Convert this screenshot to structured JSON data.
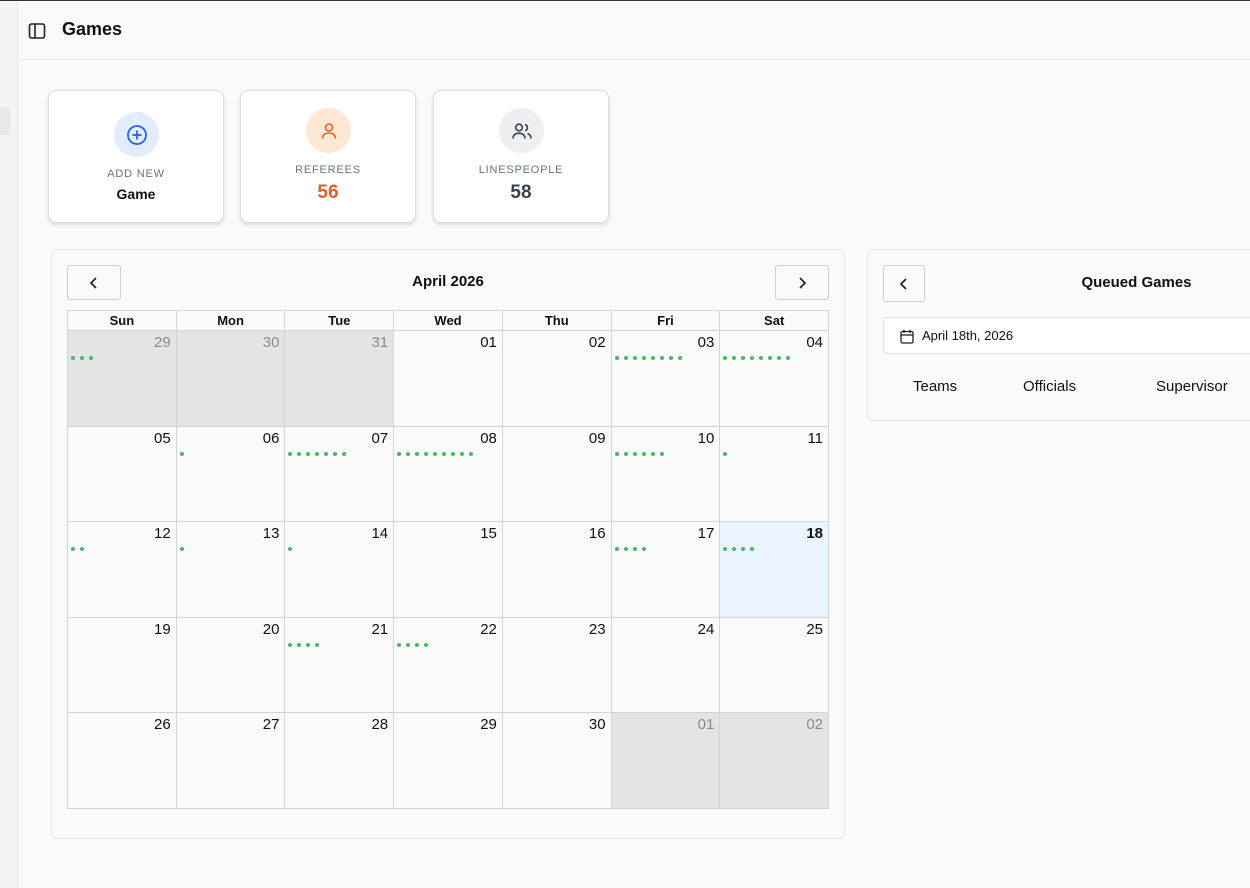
{
  "header": {
    "title": "Games"
  },
  "cards": {
    "add_new": {
      "label": "ADD NEW",
      "value": "Game"
    },
    "referees": {
      "label": "REFEREES",
      "value": "56"
    },
    "linespeople": {
      "label": "LINESPEOPLE",
      "value": "58"
    }
  },
  "colors": {
    "add": "#2563eb",
    "referees": "#d9622b",
    "linespeople": "#374151",
    "dot": "#4ab864",
    "today": "#eaf4ff"
  },
  "calendar": {
    "title": "April 2026",
    "days_of_week": [
      "Sun",
      "Mon",
      "Tue",
      "Wed",
      "Thu",
      "Fri",
      "Sat"
    ],
    "weeks": [
      [
        {
          "num": "29",
          "dots": 3,
          "off": true
        },
        {
          "num": "30",
          "dots": 0,
          "off": true
        },
        {
          "num": "31",
          "dots": 0,
          "off": true
        },
        {
          "num": "01",
          "dots": 0
        },
        {
          "num": "02",
          "dots": 0
        },
        {
          "num": "03",
          "dots": 8
        },
        {
          "num": "04",
          "dots": 8
        }
      ],
      [
        {
          "num": "05",
          "dots": 0
        },
        {
          "num": "06",
          "dots": 1
        },
        {
          "num": "07",
          "dots": 7
        },
        {
          "num": "08",
          "dots": 9
        },
        {
          "num": "09",
          "dots": 0
        },
        {
          "num": "10",
          "dots": 6
        },
        {
          "num": "11",
          "dots": 1
        }
      ],
      [
        {
          "num": "12",
          "dots": 2
        },
        {
          "num": "13",
          "dots": 1
        },
        {
          "num": "14",
          "dots": 1
        },
        {
          "num": "15",
          "dots": 0
        },
        {
          "num": "16",
          "dots": 0
        },
        {
          "num": "17",
          "dots": 4
        },
        {
          "num": "18",
          "dots": 4,
          "today": true
        }
      ],
      [
        {
          "num": "19",
          "dots": 0
        },
        {
          "num": "20",
          "dots": 0
        },
        {
          "num": "21",
          "dots": 4
        },
        {
          "num": "22",
          "dots": 4
        },
        {
          "num": "23",
          "dots": 0
        },
        {
          "num": "24",
          "dots": 0
        },
        {
          "num": "25",
          "dots": 0
        }
      ],
      [
        {
          "num": "26",
          "dots": 0
        },
        {
          "num": "27",
          "dots": 0
        },
        {
          "num": "28",
          "dots": 0
        },
        {
          "num": "29",
          "dots": 0
        },
        {
          "num": "30",
          "dots": 0
        },
        {
          "num": "01",
          "dots": 0,
          "off": true
        },
        {
          "num": "02",
          "dots": 0,
          "off": true
        }
      ]
    ]
  },
  "queue": {
    "title": "Queued Games",
    "date": "April 18th, 2026",
    "columns": [
      "Teams",
      "Officials",
      "Supervisor"
    ]
  }
}
